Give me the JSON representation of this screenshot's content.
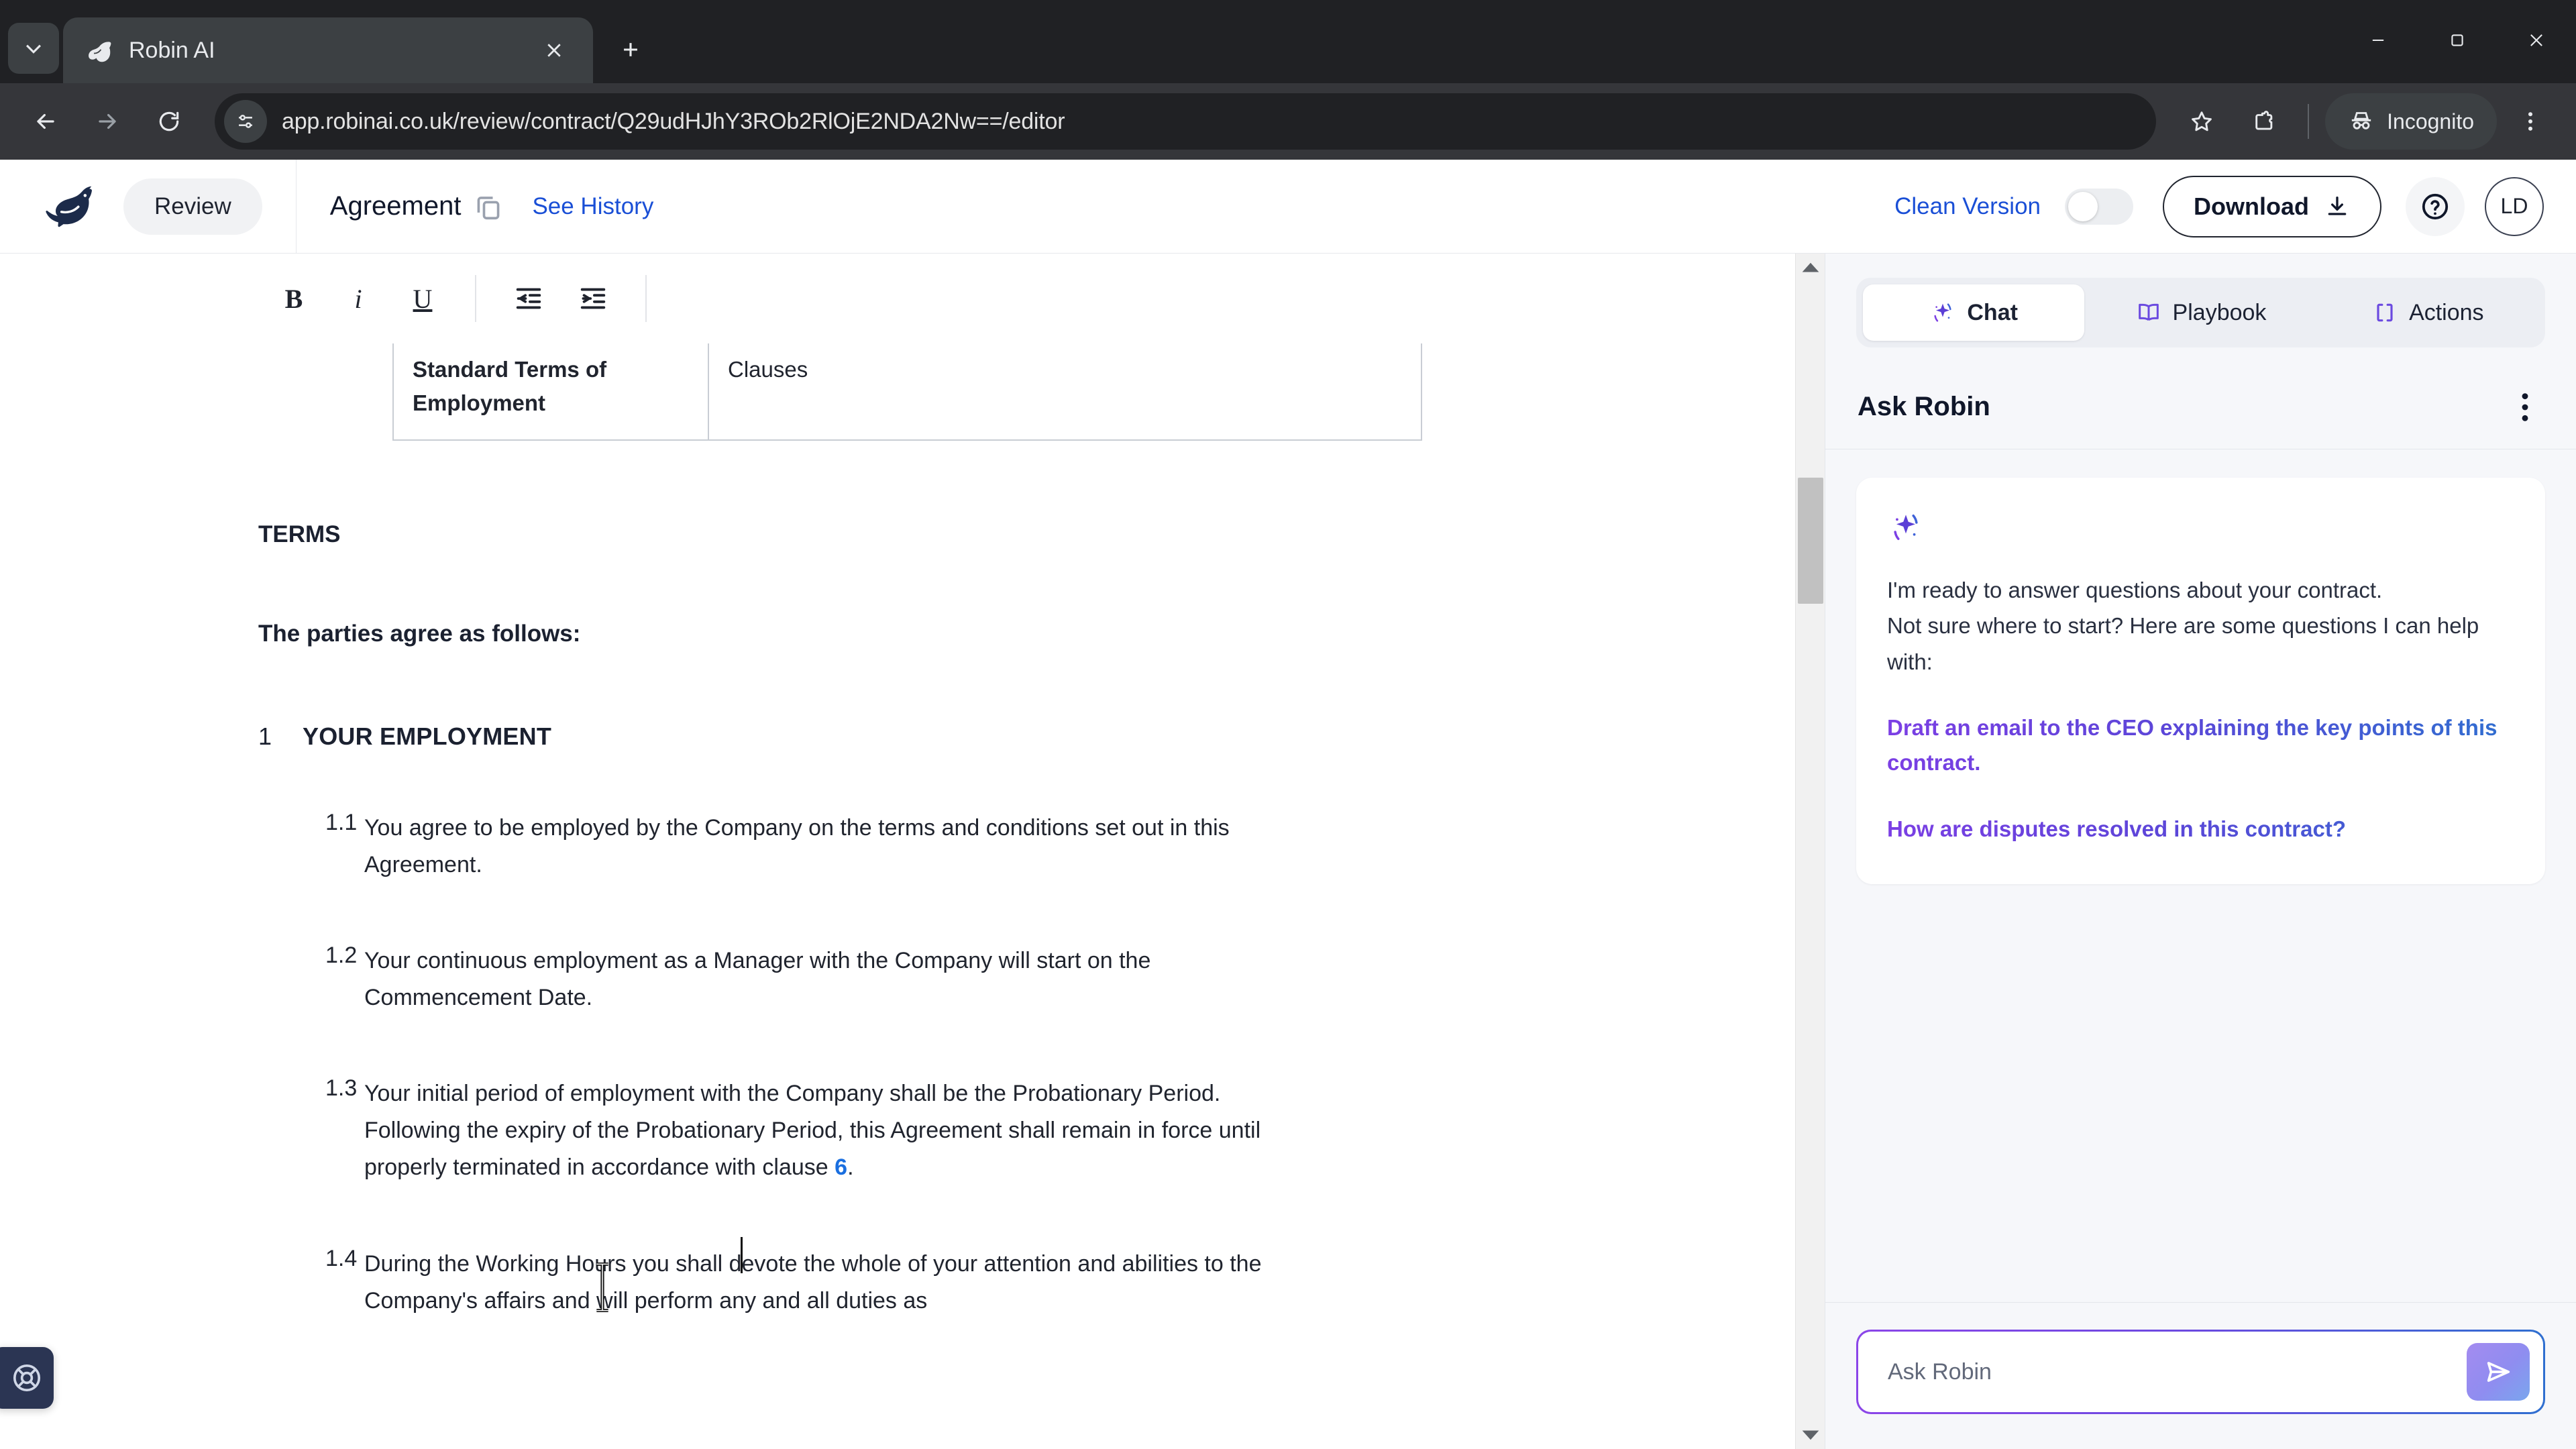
{
  "browser": {
    "tab": {
      "title": "Robin AI",
      "favicon_icon": "robin-bird-icon",
      "close_icon": "close-icon"
    },
    "tab_search_icon": "chevron-down-icon",
    "new_tab_icon": "plus-icon",
    "window_controls": {
      "minimize_icon": "minimize-icon",
      "maximize_icon": "maximize-icon",
      "close_icon": "close-icon"
    },
    "nav": {
      "back_icon": "arrow-left-icon",
      "forward_icon": "arrow-right-icon",
      "reload_icon": "reload-icon"
    },
    "omnibox": {
      "site_info_icon": "page-settings-icon",
      "url": "app.robinai.co.uk/review/contract/Q29udHJhY3ROb2RlOjE2NDA2Nw==/editor"
    },
    "actions": {
      "bookmark_icon": "star-icon",
      "extensions_icon": "puzzle-icon",
      "incognito_label": "Incognito",
      "incognito_icon": "incognito-hat-icon",
      "menu_icon": "three-dots-vertical-icon"
    }
  },
  "header": {
    "logo_icon": "robin-bird-logo",
    "review_label": "Review",
    "document_title": "Agreement",
    "copy_icon": "copy-icon",
    "see_history_label": "See History",
    "clean_version_label": "Clean Version",
    "clean_version_on": false,
    "download_label": "Download",
    "download_icon": "download-icon",
    "help_icon": "question-circle-icon",
    "avatar_initials": "LD"
  },
  "editor": {
    "toolbar": {
      "bold_label": "B",
      "italic_label": "i",
      "underline_label": "U",
      "outdent_icon": "outdent-icon",
      "indent_icon": "indent-icon"
    },
    "table": {
      "cells": [
        "Standard Terms of Employment",
        "Clauses"
      ]
    },
    "terms_heading": "TERMS",
    "parties_line": "The parties agree as follows:",
    "section": {
      "number": "1",
      "title": "YOUR EMPLOYMENT"
    },
    "clauses": [
      {
        "number": "1.1",
        "text": "You agree to be employed by the Company on the terms and conditions set out in this Agreement."
      },
      {
        "number": "1.2",
        "text": "Your continuous employment as a Manager with the Company will start on the Commencement Date."
      },
      {
        "number": "1.3",
        "text_before": "Your initial period of employment with the Company shall be the Probationary Period. Following the expiry of the Probationary Period, this Agreement shall remain in force until properly terminated in accordance with clause ",
        "xref": "6",
        "text_after": "."
      },
      {
        "number": "1.4",
        "text": "During the Working Hours you shall devote the whole of your attention and abilities to the Company's affairs and will perform any and all duties as"
      }
    ],
    "scrollbar": {
      "up_icon": "caret-up-icon",
      "down_icon": "caret-down-icon"
    }
  },
  "panel": {
    "tabs": [
      {
        "label": "Chat",
        "icon": "sparkle-icon",
        "active": true
      },
      {
        "label": "Playbook",
        "icon": "book-icon",
        "active": false
      },
      {
        "label": "Actions",
        "icon": "brackets-icon",
        "active": false
      }
    ],
    "title": "Ask Robin",
    "menu_icon": "three-dots-vertical-icon",
    "message": {
      "icon": "sparkle-icon",
      "line1": "I'm ready to answer questions about your contract.",
      "line2": "Not sure where to start? Here are some questions I can help with:"
    },
    "suggestions": [
      "Draft an email to the CEO explaining the key points of this contract.",
      "How are disputes resolved in this contract?"
    ],
    "composer": {
      "placeholder": "Ask Robin",
      "send_icon": "send-icon"
    }
  },
  "support_widget": {
    "icon": "lifebuoy-icon"
  },
  "colors": {
    "brand_navy": "#20304f",
    "link_blue": "#1a4fd6",
    "xref_blue": "#1a6fe0",
    "accent_purple": "#7b3fe4",
    "accent_blue": "#2f6fd0",
    "chrome_dark": "#202124"
  }
}
